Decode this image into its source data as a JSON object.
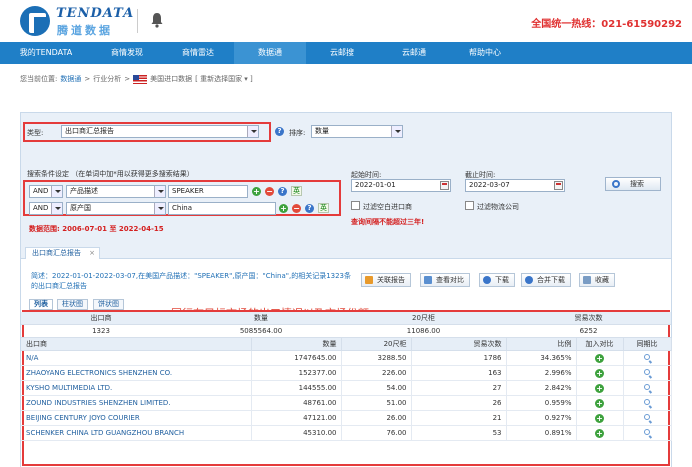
{
  "header": {
    "brand_en": "TENDATA",
    "brand_cn": "腾道数据",
    "hotline": "全国统一热线：021-61590292"
  },
  "nav": {
    "items": [
      "我的TENDATA",
      "商情发现",
      "商情雷达",
      "数据通",
      "云邮搜",
      "云邮通",
      "帮助中心"
    ],
    "active_index": 3
  },
  "breadcrumb": {
    "prefix": "您当前位置:",
    "items": [
      "数据通",
      "行业分析",
      "美国进口数据"
    ],
    "action": "[ 重新选择国家 ▾ ]",
    "separator": ">"
  },
  "filters": {
    "type_label": "类型:",
    "type_value": "出口商汇总报告",
    "sort_label": "排序:",
    "sort_value": "数量",
    "condition_label": "搜索条件设定 （在单词中加*用以获得更多搜索结果）",
    "rows": [
      {
        "logic": "AND",
        "field": "产品描述",
        "value": "SPEAKER",
        "lang_btn": "英"
      },
      {
        "logic": "AND",
        "field": "原产国",
        "value": "China",
        "lang_btn": "英"
      }
    ],
    "start_label": "起始时间:",
    "start_value": "2022-01-01",
    "end_label": "截止时间:",
    "end_value": "2022-03-07",
    "chk_empty_importer": "过滤空白进口商",
    "chk_logistics": "过滤物流公司",
    "warning": "查询间隔不能超过三年!",
    "range_text": "数据范围: 2006-07-01 至 2022-04-15",
    "search_btn": "搜索"
  },
  "report": {
    "tab_label": "出口商汇总报告",
    "tab_close": "×",
    "summary": "简述：2022-01-01-2022-03-07,在美国产品描述：\"SPEAKER\",原产国：\"China\",的相关记录1323条的出口商汇总报告",
    "toolbar": [
      "关联报告",
      "查看对比",
      "下载",
      "合并下载",
      "收藏"
    ],
    "annotation": "同行在目标市场的出口情况以及市场份额",
    "view_tabs": [
      "列表",
      "柱状图",
      "饼状图"
    ],
    "totals": {
      "headers": [
        "出口商",
        "数量",
        "20尺柜",
        "贸易次数"
      ],
      "values": [
        "1323",
        "5085564.00",
        "11086.00",
        "6252"
      ]
    },
    "columns": [
      "出口商",
      "数量",
      "20尺柜",
      "贸易次数",
      "比例",
      "加入对比",
      "同期比"
    ],
    "rows": [
      {
        "name": "N/A",
        "qty": "1747645.00",
        "teu": "3288.50",
        "trades": "1786",
        "ratio": "34.365%"
      },
      {
        "name": "ZHAOYANG ELECTRONICS SHENZHEN CO.",
        "qty": "152377.00",
        "teu": "226.00",
        "trades": "163",
        "ratio": "2.996%"
      },
      {
        "name": "KYSHO MULTIMEDIA LTD.",
        "qty": "144555.00",
        "teu": "54.00",
        "trades": "27",
        "ratio": "2.842%"
      },
      {
        "name": "ZOUND INDUSTRIES SHENZHEN LIMITED.",
        "qty": "48761.00",
        "teu": "51.00",
        "trades": "26",
        "ratio": "0.959%"
      },
      {
        "name": "BEIJING CENTURY JOYO COURIER",
        "qty": "47121.00",
        "teu": "26.00",
        "trades": "21",
        "ratio": "0.927%"
      },
      {
        "name": "SCHENKER CHINA LTD GUANGZHOU BRANCH",
        "qty": "45310.00",
        "teu": "76.00",
        "trades": "53",
        "ratio": "0.891%"
      }
    ]
  },
  "colors": {
    "nav_bg": "#1f7fc7",
    "brand_blue": "#1b6fb6",
    "accent_red": "#e03030",
    "highlight_box": "#e43b3b"
  }
}
